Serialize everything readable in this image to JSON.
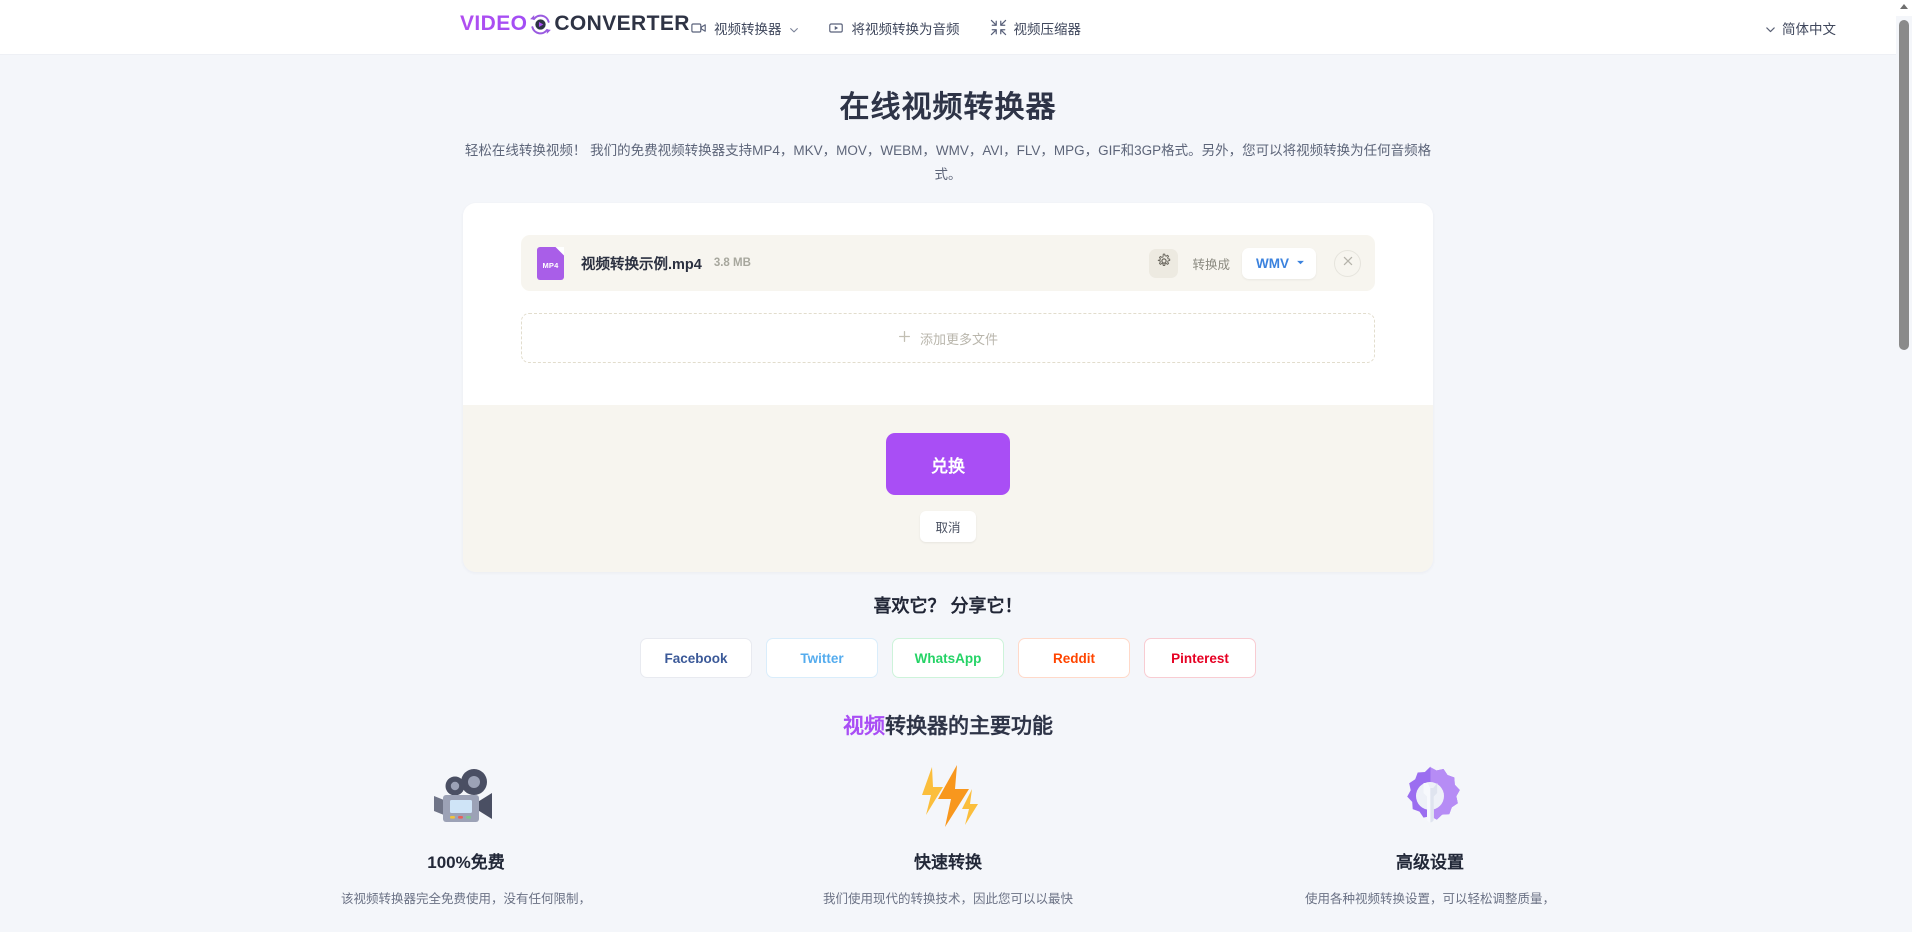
{
  "header": {
    "logo": {
      "part1": "VIDEO",
      "part2": "CONVERTER",
      "mark_icon": "circular-refresh-play-icon"
    },
    "nav": [
      {
        "label": "视频转换器",
        "icon": "video-camera-icon",
        "has_chevron": true
      },
      {
        "label": "将视频转换为音频",
        "icon": "play-box-icon",
        "has_chevron": false
      },
      {
        "label": "视频压缩器",
        "icon": "compress-arrows-icon",
        "has_chevron": false
      }
    ],
    "language": {
      "label": "简体中文",
      "icon": "chevron-down-icon"
    }
  },
  "hero": {
    "title": "在线视频转换器",
    "description": "轻松在线转换视频！ 我们的免费视频转换器支持MP4，MKV，MOV，WEBM，WMV，AVI，FLV，MPG，GIF和3GP格式。另外，您可以将视频转换为任何音频格式。"
  },
  "converter": {
    "file": {
      "icon_label": "MP4",
      "name": "视频转换示例.mp4",
      "size": "3.8 MB",
      "settings_icon": "gear-icon",
      "convert_to_label": "转换成",
      "format_value": "WMV",
      "format_caret_icon": "caret-down-icon",
      "remove_icon": "close-icon"
    },
    "add_more": {
      "label": "添加更多文件",
      "icon": "plus-icon"
    },
    "convert_button": "兑换",
    "cancel_button": "取消"
  },
  "share": {
    "title": "喜欢它？ 分享它！",
    "buttons": [
      {
        "label": "Facebook",
        "color": "#3b5998",
        "border": "#e8eaf0"
      },
      {
        "label": "Twitter",
        "color": "#55acee",
        "border": "#d9edfb"
      },
      {
        "label": "WhatsApp",
        "color": "#25d366",
        "border": "#cdf3da"
      },
      {
        "label": "Reddit",
        "color": "#ff4500",
        "border": "#ffd9c9"
      },
      {
        "label": "Pinterest",
        "color": "#e60023",
        "border": "#f8ccd2"
      }
    ]
  },
  "features": {
    "heading_highlight": "视频",
    "heading_rest": "转换器的主要功能",
    "items": [
      {
        "icon": "movie-camera-icon",
        "title": "100%免费",
        "desc": "该视频转换器完全免费使用，没有任何限制，"
      },
      {
        "icon": "lightning-bolts-icon",
        "title": "快速转换",
        "desc": "我们使用现代的转换技术，因此您可以以最快"
      },
      {
        "icon": "gear-wrench-icon",
        "title": "高级设置",
        "desc": "使用各种视频转换设置，可以轻松调整质量，"
      }
    ]
  },
  "colors": {
    "accent_purple": "#a94ef5",
    "page_bg": "#f4f6fa",
    "card_beige": "#f7f5ef",
    "format_blue": "#3b82de"
  }
}
